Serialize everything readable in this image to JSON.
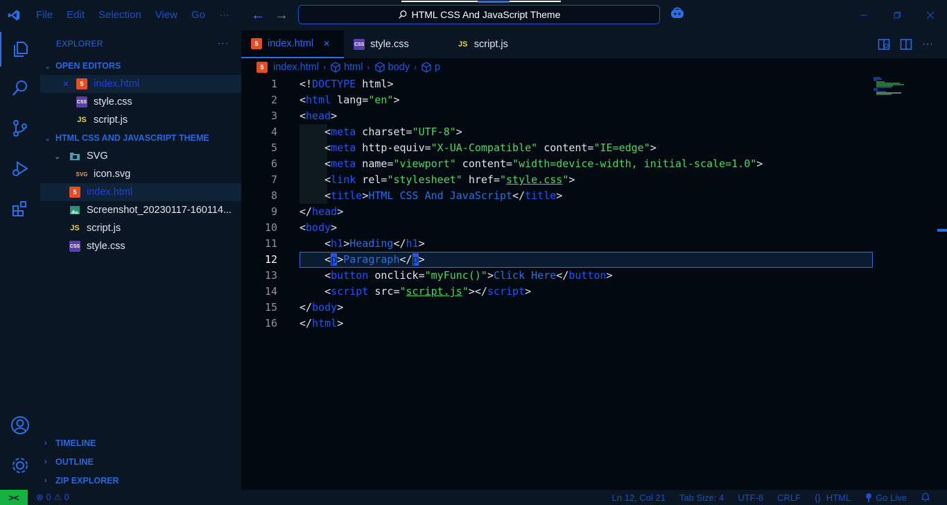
{
  "titlebar": {
    "menu": [
      "File",
      "Edit",
      "Selection",
      "View",
      "Go",
      "···"
    ],
    "command_center": "HTML CSS And JavaScript Theme"
  },
  "sidebar": {
    "title": "EXPLORER",
    "more": "···",
    "open_editors_label": "OPEN EDITORS",
    "open_editors": [
      {
        "name": "index.html",
        "icon": "html",
        "selected": true
      },
      {
        "name": "style.css",
        "icon": "css"
      },
      {
        "name": "script.js",
        "icon": "js"
      }
    ],
    "folder_label": "HTML CSS AND JAVASCRIPT THEME",
    "tree": {
      "svg_folder": "SVG",
      "svg_file": "icon.svg",
      "files": [
        {
          "name": "index.html",
          "icon": "html",
          "selected": true
        },
        {
          "name": "Screenshot_20230117-160114...",
          "icon": "img"
        },
        {
          "name": "script.js",
          "icon": "js"
        },
        {
          "name": "style.css",
          "icon": "css"
        }
      ]
    },
    "bottom_sections": [
      "TIMELINE",
      "OUTLINE",
      "ZIP EXPLORER"
    ]
  },
  "tabs": [
    {
      "label": "index.html",
      "icon": "html",
      "active": true
    },
    {
      "label": "style.css",
      "icon": "css"
    },
    {
      "label": "script.js",
      "icon": "js"
    }
  ],
  "breadcrumb": [
    "index.html",
    "html",
    "body",
    "p"
  ],
  "editor": {
    "current_line": 12,
    "line_numbers": [
      "1",
      "2",
      "3",
      "4",
      "5",
      "6",
      "7",
      "8",
      "9",
      "10",
      "11",
      "12",
      "13",
      "14",
      "15",
      "16"
    ]
  },
  "statusbar": {
    "remote": "><",
    "problems": "⊗ 0 ⚠ 0",
    "position": "Ln 12, Col 21",
    "tab_size": "Tab Size: 4",
    "encoding": "UTF-8",
    "eol": "CRLF",
    "braces": "{}",
    "language": "HTML",
    "golive": "Go Live"
  },
  "colors": {
    "background": "#030911",
    "panel": "#0b1624",
    "accent": "#2b6ee8",
    "tag": "#1f55ff",
    "string": "#4cd964",
    "remote": "#15b040"
  }
}
